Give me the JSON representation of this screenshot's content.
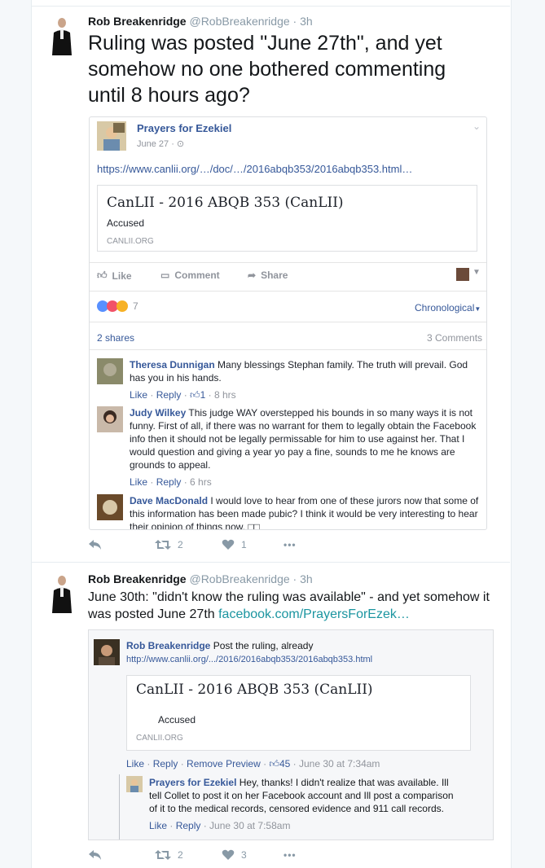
{
  "tweet1": {
    "name": "Rob Breakenridge",
    "handle": "@RobBreakenridge",
    "time": "· 3h",
    "text": "Ruling was posted \"June 27th\", and yet somehow no one bothered commenting until 8 hours ago?",
    "retweets": "2",
    "likes": "1",
    "embed": {
      "page": "Prayers for Ezekiel",
      "date": "June 27 · ",
      "link": "https://www.canlii.org/…/doc/…/2016abqb353/2016abqb353.html…",
      "card": {
        "title": "CanLII - 2016 ABQB 353 (CanLII)",
        "desc": "Accused",
        "source": "CANLII.ORG"
      },
      "actions": {
        "like": "Like",
        "comment": "Comment",
        "share": "Share"
      },
      "reactions_count": "7",
      "sort": "Chronological",
      "shares": "2 shares",
      "comments_count": "3 Comments",
      "comments": [
        {
          "name": "Theresa Dunnigan",
          "text": "Many blessings Stephan family. The truth will prevail. God has you in his hands.",
          "like": "Like",
          "reply": "Reply",
          "likes": "1",
          "time": "· 8 hrs"
        },
        {
          "name": "Judy Wilkey",
          "text": "This judge WAY overstepped his bounds in so many ways it is not funny. First of all, if there was no warrant for them to legally obtain the Facebook info then it should not be legally permissable for him to use against her. That I would question and giving a year yo pay a fine, sounds to me he knows are grounds to appeal.",
          "like": "Like",
          "reply": "Reply",
          "time": "· 6 hrs"
        },
        {
          "name": "Dave MacDonald",
          "text": "I would love to hear from one of these jurors now that some of this information has been made pubic? I think it would be very interesting to hear their opinion of things now. □□"
        }
      ]
    }
  },
  "tweet2": {
    "name": "Rob Breakenridge",
    "handle": "@RobBreakenridge",
    "time": "· 3h",
    "text": "June 30th: \"didn't know the ruling was available\" - and yet somehow it was posted June 27th ",
    "link": "facebook.com/PrayersForEzek…",
    "retweets": "2",
    "likes": "3",
    "embed": {
      "author": "Rob Breakenridge",
      "text": "Post the ruling, already",
      "url": "http://www.canlii.org/.../2016/2016abqb353/2016abqb353.html",
      "card": {
        "title": "CanLII - 2016 ABQB 353 (CanLII)",
        "desc": "Accused",
        "source": "CANLII.ORG"
      },
      "meta": {
        "like": "Like",
        "reply": "Reply",
        "remove": "Remove Preview",
        "likes": "45",
        "time": "· June 30 at 7:34am"
      },
      "reply": {
        "name": "Prayers for Ezekiel",
        "text": "Hey, thanks! I didn't realize that was available. Ill tell Collet to post it on her Facebook account and Ill post a comparison of it to the medical records, censored evidence and 911 call records.",
        "like": "Like",
        "reply_label": "Reply",
        "time": "· June 30 at 7:58am"
      }
    }
  },
  "colors": {
    "twitter_gray": "#8899a6",
    "fb_blue": "#365899",
    "link_teal": "#1b95a0"
  }
}
